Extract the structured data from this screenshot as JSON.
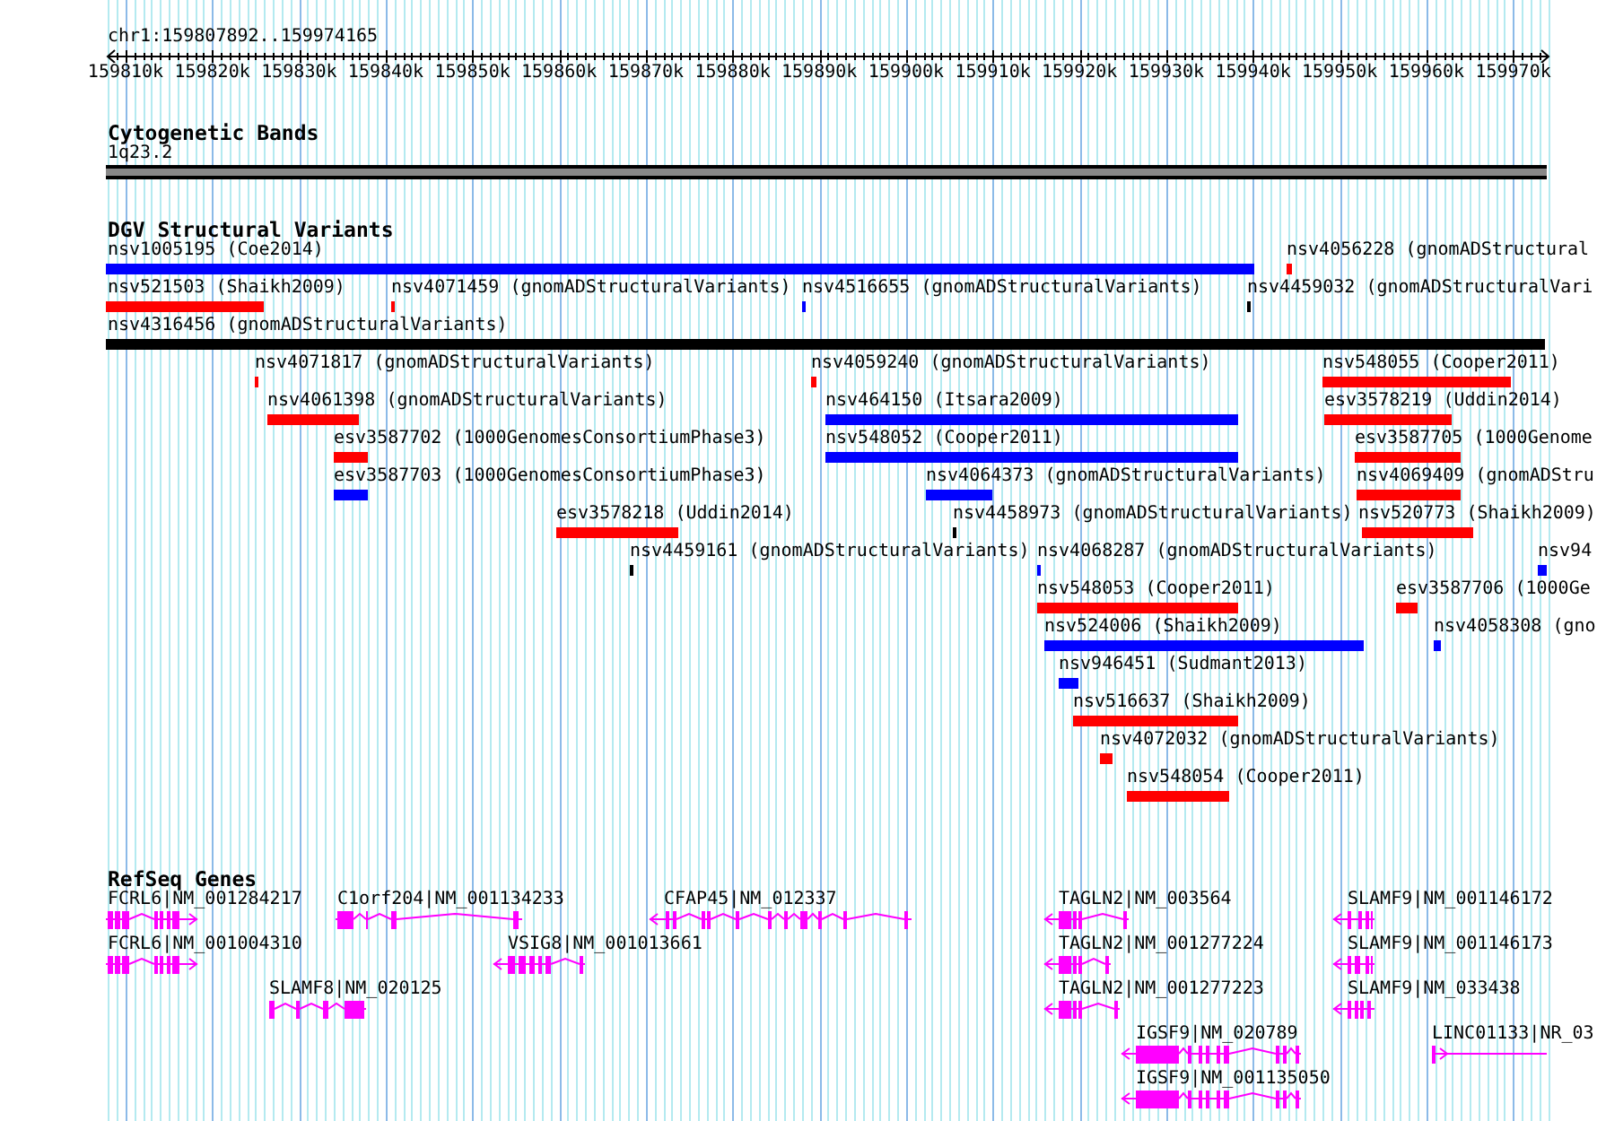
{
  "location": "chr1:159807892..159974165",
  "ruler": {
    "ticks": [
      "159810k",
      "159820k",
      "159830k",
      "159840k",
      "159850k",
      "159860k",
      "159870k",
      "159880k",
      "159890k",
      "159900k",
      "159910k",
      "159920k",
      "159930k",
      "159940k",
      "159950k",
      "159960k",
      "159970k"
    ]
  },
  "tracks": [
    {
      "kind": "bands",
      "title": "Cytogenetic Bands",
      "features": [
        {
          "label": "1q23.2"
        }
      ]
    },
    {
      "kind": "variants",
      "title": "DGV Structural Variants",
      "features": [
        {
          "label": "nsv1005195 (Coe2014)",
          "color": "#0000ff"
        },
        {
          "label": "nsv4056228 (gnomADStructural",
          "color": "#ff0000"
        },
        {
          "label": "nsv521503 (Shaikh2009)",
          "color": "#ff0000"
        },
        {
          "label": "nsv4071459 (gnomADStructuralVariants)",
          "color": "#ff0000"
        },
        {
          "label": "nsv4516655 (gnomADStructuralVariants)",
          "color": "#0000ff"
        },
        {
          "label": "nsv4459032 (gnomADStructuralVari",
          "color": "#000000"
        },
        {
          "label": "nsv4316456 (gnomADStructuralVariants)",
          "color": "#000000"
        },
        {
          "label": "nsv4071817 (gnomADStructuralVariants)",
          "color": "#ff0000"
        },
        {
          "label": "nsv4059240 (gnomADStructuralVariants)",
          "color": "#ff0000"
        },
        {
          "label": "nsv548055 (Cooper2011)",
          "color": "#ff0000"
        },
        {
          "label": "nsv4061398 (gnomADStructuralVariants)",
          "color": "#ff0000"
        },
        {
          "label": "nsv464150 (Itsara2009)",
          "color": "#0000ff"
        },
        {
          "label": "esv3578219 (Uddin2014)",
          "color": "#ff0000"
        },
        {
          "label": "esv3587702 (1000GenomesConsortiumPhase3)",
          "color": "#ff0000"
        },
        {
          "label": "nsv548052 (Cooper2011)",
          "color": "#0000ff"
        },
        {
          "label": "esv3587705 (1000Genome",
          "color": "#ff0000"
        },
        {
          "label": "esv3587703 (1000GenomesConsortiumPhase3)",
          "color": "#0000ff"
        },
        {
          "label": "nsv4064373 (gnomADStructuralVariants)",
          "color": "#0000ff"
        },
        {
          "label": "nsv4069409 (gnomADStru",
          "color": "#ff0000"
        },
        {
          "label": "esv3578218 (Uddin2014)",
          "color": "#ff0000"
        },
        {
          "label": "nsv4458973 (gnomADStructuralVariants)",
          "color": "#000000"
        },
        {
          "label": "nsv520773 (Shaikh2009)",
          "color": "#ff0000"
        },
        {
          "label": "nsv4459161 (gnomADStructuralVariants)",
          "color": "#000000"
        },
        {
          "label": "nsv4068287 (gnomADStructuralVariants)",
          "color": "#0000ff"
        },
        {
          "label": "nsv94",
          "color": "#0000ff"
        },
        {
          "label": "nsv548053 (Cooper2011)",
          "color": "#ff0000"
        },
        {
          "label": "esv3587706 (1000Ge",
          "color": "#ff0000"
        },
        {
          "label": "nsv524006 (Shaikh2009)",
          "color": "#0000ff"
        },
        {
          "label": "nsv4058308 (gno",
          "color": "#0000ff"
        },
        {
          "label": "nsv946451 (Sudmant2013)",
          "color": "#0000ff"
        },
        {
          "label": "nsv516637 (Shaikh2009)",
          "color": "#ff0000"
        },
        {
          "label": "nsv4072032 (gnomADStructuralVariants)",
          "color": "#ff0000"
        },
        {
          "label": "nsv548054 (Cooper2011)",
          "color": "#ff0000"
        }
      ]
    },
    {
      "kind": "genes",
      "title": "RefSeq Genes",
      "features": [
        {
          "label": "FCRL6|NM_001284217",
          "kind": "forward"
        },
        {
          "label": "C1orf204|NM_001134233",
          "kind": "plain"
        },
        {
          "label": "CFAP45|NM_012337",
          "kind": "reverse"
        },
        {
          "label": "TAGLN2|NM_003564",
          "kind": "reverse"
        },
        {
          "label": "SLAMF9|NM_001146172",
          "kind": "reverse"
        },
        {
          "label": "FCRL6|NM_001004310",
          "kind": "forward"
        },
        {
          "label": "VSIG8|NM_001013661",
          "kind": "reverse"
        },
        {
          "label": "TAGLN2|NM_001277224",
          "kind": "reverse"
        },
        {
          "label": "SLAMF9|NM_001146173",
          "kind": "reverse"
        },
        {
          "label": "SLAMF8|NM_020125",
          "kind": "plain"
        },
        {
          "label": "TAGLN2|NM_001277223",
          "kind": "reverse"
        },
        {
          "label": "SLAMF9|NM_033438",
          "kind": "reverse"
        },
        {
          "label": "IGSF9|NM_020789",
          "kind": "reverse"
        },
        {
          "label": "LINC01133|NR_03",
          "kind": "forward"
        },
        {
          "label": "IGSF9|NM_001135050",
          "kind": "reverse"
        }
      ]
    }
  ]
}
